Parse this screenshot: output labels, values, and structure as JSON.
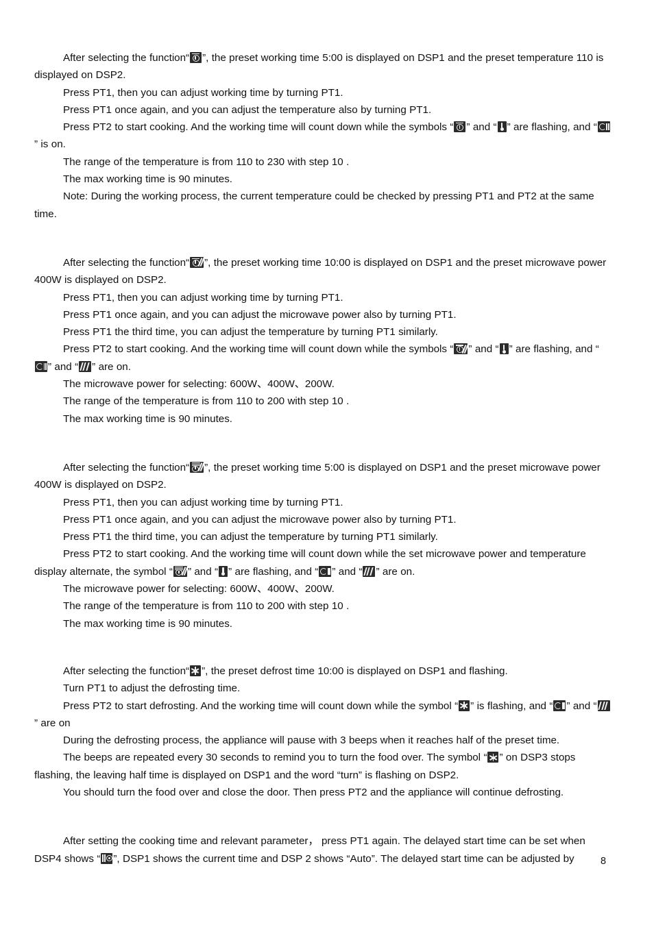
{
  "document": {
    "page_number": "8",
    "sections": [
      {
        "id": "grill-function",
        "lines": [
          {
            "indent": true,
            "parts": [
              {
                "t": "text",
                "v": "After selecting the function"
              },
              {
                "t": "text",
                "v": "“"
              },
              {
                "t": "icon",
                "v": "grill-icon"
              },
              {
                "t": "text",
                "v": "”, the preset working time 5:00 is displayed on DSP1 and the preset temperature 110   is displayed on DSP2."
              }
            ]
          },
          {
            "indent": true,
            "parts": [
              {
                "t": "text",
                "v": "Press PT1, then you can adjust working time by turning PT1."
              }
            ]
          },
          {
            "indent": true,
            "parts": [
              {
                "t": "text",
                "v": "Press PT1 once again, and you can adjust the temperature also by turning PT1."
              }
            ]
          },
          {
            "indent": true,
            "parts": [
              {
                "t": "text",
                "v": "Press PT2 to start cooking. And the working time will count down while the symbols “"
              },
              {
                "t": "icon",
                "v": "grill-icon"
              },
              {
                "t": "text",
                "v": "” and “"
              },
              {
                "t": "icon",
                "v": "thermometer-icon"
              },
              {
                "t": "text",
                "v": "” are flashing, and “"
              },
              {
                "t": "icon",
                "v": "fan-icon"
              },
              {
                "t": "text",
                "v": "” is on."
              }
            ]
          },
          {
            "indent": true,
            "parts": [
              {
                "t": "text",
                "v": "The range of the temperature is from 110   to 230   with step 10  ."
              }
            ]
          },
          {
            "indent": true,
            "parts": [
              {
                "t": "text",
                "v": "The max working time is 90 minutes."
              }
            ]
          },
          {
            "indent": true,
            "parts": [
              {
                "t": "text",
                "v": "Note: During the working process, the current temperature could be checked by pressing PT1 and PT2 at the same time."
              }
            ]
          }
        ]
      },
      {
        "id": "grill-microwave-combi",
        "lines": [
          {
            "indent": true,
            "parts": [
              {
                "t": "text",
                "v": "After selecting the function“"
              },
              {
                "t": "icon",
                "v": "grill-microwave-icon"
              },
              {
                "t": "text",
                "v": "”, the preset working time 10:00 is displayed on DSP1 and the preset microwave power 400W is displayed on DSP2."
              }
            ]
          },
          {
            "indent": true,
            "parts": [
              {
                "t": "text",
                "v": "Press PT1, then you can adjust working time by turning PT1."
              }
            ]
          },
          {
            "indent": true,
            "parts": [
              {
                "t": "text",
                "v": "Press PT1 once again, and you can adjust the microwave power also by turning PT1."
              }
            ]
          },
          {
            "indent": true,
            "parts": [
              {
                "t": "text",
                "v": "Press PT1 the third time, you can adjust the temperature by turning PT1 similarly."
              }
            ]
          },
          {
            "indent": true,
            "parts": [
              {
                "t": "text",
                "v": "Press PT2 to start cooking. And the working time will count down while the symbols “"
              },
              {
                "t": "icon",
                "v": "grill-microwave-icon"
              },
              {
                "t": "text",
                "v": "” and “"
              },
              {
                "t": "icon",
                "v": "thermometer-icon"
              },
              {
                "t": "text",
                "v": "” are flashing, and “"
              },
              {
                "t": "icon",
                "v": "fan-icon"
              },
              {
                "t": "text",
                "v": "” and “"
              },
              {
                "t": "icon",
                "v": "microwave-waves-icon"
              },
              {
                "t": "text",
                "v": "” are on."
              }
            ]
          },
          {
            "indent": true,
            "parts": [
              {
                "t": "text",
                "v": "The microwave power for selecting: 600W、400W、200W."
              }
            ]
          },
          {
            "indent": true,
            "parts": [
              {
                "t": "text",
                "v": "The range of the temperature is from 110   to 200   with step 10  ."
              }
            ]
          },
          {
            "indent": true,
            "parts": [
              {
                "t": "text",
                "v": "The max working time is 90 minutes."
              }
            ]
          }
        ]
      },
      {
        "id": "convection-microwave-combi",
        "lines": [
          {
            "indent": true,
            "parts": [
              {
                "t": "text",
                "v": "After selecting the function“"
              },
              {
                "t": "icon",
                "v": "convection-microwave-icon"
              },
              {
                "t": "text",
                "v": "”, the preset working time 5:00 is displayed on DSP1 and the preset microwave power 400W is displayed on DSP2."
              }
            ]
          },
          {
            "indent": true,
            "parts": [
              {
                "t": "text",
                "v": "Press PT1, then you can adjust working time by turning PT1."
              }
            ]
          },
          {
            "indent": true,
            "parts": [
              {
                "t": "text",
                "v": "Press PT1 once again, and you can adjust the microwave power also by turning PT1."
              }
            ]
          },
          {
            "indent": true,
            "parts": [
              {
                "t": "text",
                "v": "Press PT1 the third time, you can adjust the temperature by turning PT1 similarly."
              }
            ]
          },
          {
            "indent": true,
            "parts": [
              {
                "t": "text",
                "v": "Press PT2 to start cooking. And the working time will count down while the set microwave power and temperature display alternate, the symbol “"
              },
              {
                "t": "icon",
                "v": "convection-microwave-icon"
              },
              {
                "t": "text",
                "v": "” and “"
              },
              {
                "t": "icon",
                "v": "thermometer-icon"
              },
              {
                "t": "text",
                "v": "” are flashing, and “"
              },
              {
                "t": "icon",
                "v": "fan-icon"
              },
              {
                "t": "text",
                "v": "” and “"
              },
              {
                "t": "icon",
                "v": "microwave-waves-icon"
              },
              {
                "t": "text",
                "v": "” are on."
              }
            ]
          },
          {
            "indent": true,
            "parts": [
              {
                "t": "text",
                "v": "The microwave power for selecting: 600W、400W、200W."
              }
            ]
          },
          {
            "indent": true,
            "parts": [
              {
                "t": "text",
                "v": "The range of the temperature is from 110   to 200   with step 10  ."
              }
            ]
          },
          {
            "indent": true,
            "parts": [
              {
                "t": "text",
                "v": "The max working time is 90 minutes."
              }
            ]
          }
        ]
      },
      {
        "id": "defrost-function",
        "lines": [
          {
            "indent": true,
            "parts": [
              {
                "t": "text",
                "v": "After selecting the function“"
              },
              {
                "t": "icon",
                "v": "defrost-snowflake-icon"
              },
              {
                "t": "text",
                "v": "”, the preset defrost time 10:00 is displayed on DSP1 and flashing."
              }
            ]
          },
          {
            "indent": true,
            "parts": [
              {
                "t": "text",
                "v": "Turn PT1 to adjust the defrosting time."
              }
            ]
          },
          {
            "indent": true,
            "parts": [
              {
                "t": "text",
                "v": "Press PT2 to start defrosting. And the working time will count down while the symbol “"
              },
              {
                "t": "icon",
                "v": "defrost-snowflake-icon"
              },
              {
                "t": "text",
                "v": "” is flashing, and “"
              },
              {
                "t": "icon",
                "v": "fan-icon"
              },
              {
                "t": "text",
                "v": "” and “"
              },
              {
                "t": "icon",
                "v": "microwave-waves-icon"
              },
              {
                "t": "text",
                "v": "” are on"
              }
            ]
          },
          {
            "indent": true,
            "parts": [
              {
                "t": "text",
                "v": "During the defrosting process, the appliance will pause with 3 beeps when it reaches half of the preset time."
              }
            ]
          },
          {
            "indent": true,
            "parts": [
              {
                "t": "text",
                "v": "The beeps are repeated every 30 seconds to remind you to turn the food over. The symbol “"
              },
              {
                "t": "icon",
                "v": "defrost-snowflake-icon"
              },
              {
                "t": "text",
                "v": "” on DSP3 stops flashing, the leaving half time is displayed on DSP1 and the word “turn” is flashing on DSP2."
              }
            ]
          },
          {
            "indent": true,
            "parts": [
              {
                "t": "text",
                "v": "You should turn the food over and close the door. Then press PT2 and the appliance will continue defrosting."
              }
            ]
          }
        ]
      },
      {
        "id": "delayed-start",
        "lines": [
          {
            "indent": true,
            "parts": [
              {
                "t": "text",
                "v": "After setting the cooking time and relevant parameter， press PT1 again. The delayed start time can be set when DSP4 shows “"
              },
              {
                "t": "icon",
                "v": "clock-icon"
              },
              {
                "t": "text",
                "v": "”, DSP1 shows the current time and DSP 2 shows “Auto”. The delayed start time can be adjusted by"
              }
            ]
          }
        ]
      }
    ]
  }
}
